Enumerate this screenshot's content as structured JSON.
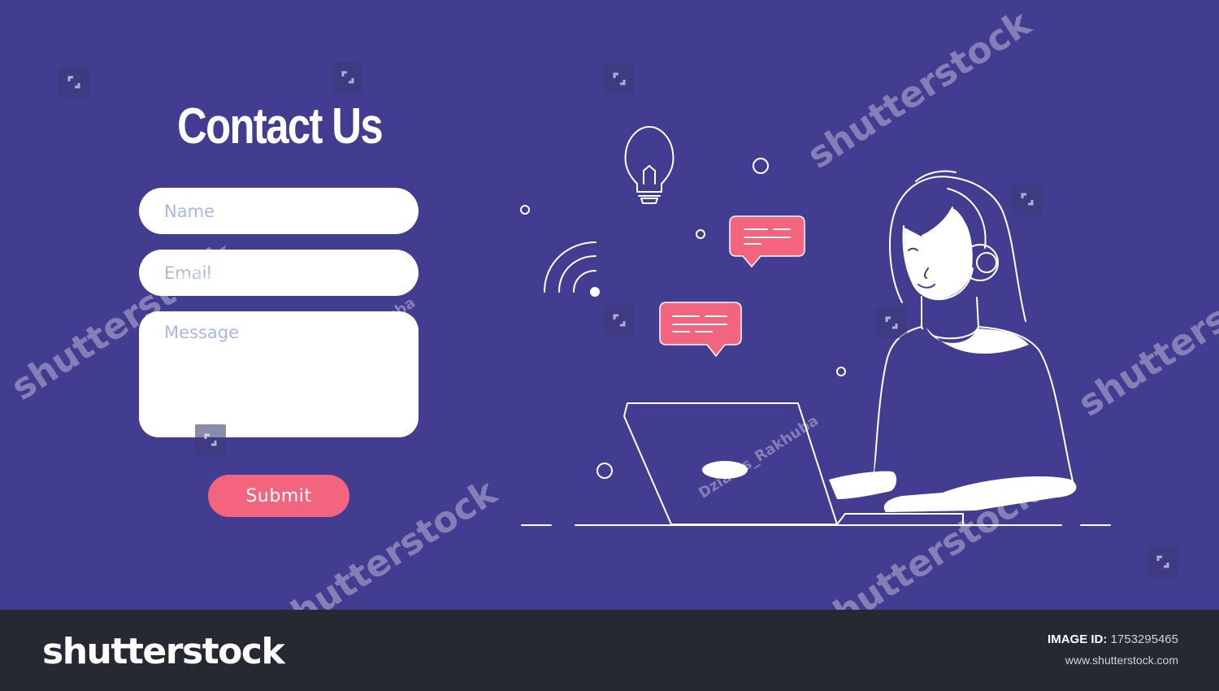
{
  "form": {
    "title": "Contact Us",
    "name_placeholder": "Name",
    "email_placeholder": "Email",
    "message_placeholder": "Message",
    "submit_label": "Submit"
  },
  "watermark": {
    "text": "shutterstock",
    "author": "Dzianis_Rakhuba"
  },
  "footer": {
    "brand": "shutterstock",
    "image_id_label": "IMAGE ID:",
    "image_id_value": "1753295465",
    "site": "www.shutterstock.com"
  },
  "colors": {
    "background": "#433d91",
    "accent": "#f3657e",
    "footer": "#262932"
  },
  "icons": [
    "lightbulb-icon",
    "wifi-icon",
    "chat-bubble-icon",
    "headset-icon",
    "laptop-icon"
  ]
}
